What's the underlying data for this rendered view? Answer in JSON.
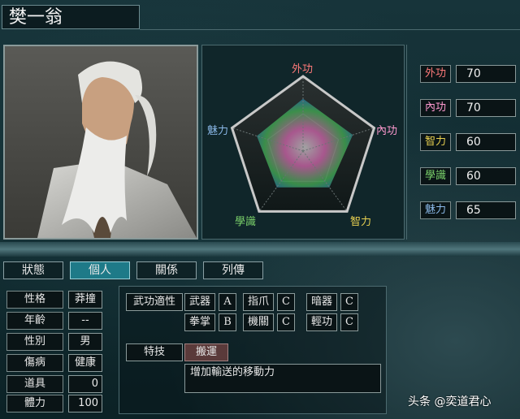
{
  "character": {
    "name": "樊一翁"
  },
  "radar": {
    "labels": {
      "outer": "外功",
      "inner": "內功",
      "wisdom": "智力",
      "knowledge": "學識",
      "charm": "魅力"
    },
    "label_colors": {
      "outer": "#ff7a7a",
      "inner": "#ff9ad0",
      "wisdom": "#e8d050",
      "knowledge": "#7ad06a",
      "charm": "#8ab8e8"
    }
  },
  "stats": [
    {
      "name": "外功",
      "value": "70",
      "color": "#ff7a7a"
    },
    {
      "name": "內功",
      "value": "70",
      "color": "#ff9ad0"
    },
    {
      "name": "智力",
      "value": "60",
      "color": "#e8d050"
    },
    {
      "name": "學識",
      "value": "60",
      "color": "#7ad06a"
    },
    {
      "name": "魅力",
      "value": "65",
      "color": "#8ab8e8"
    }
  ],
  "tabs": [
    {
      "label": "狀態",
      "active": false
    },
    {
      "label": "個人",
      "active": true
    },
    {
      "label": "關係",
      "active": false
    },
    {
      "label": "列傳",
      "active": false
    }
  ],
  "info": [
    {
      "name": "性格",
      "value": "莽撞"
    },
    {
      "name": "年齡",
      "value": "--"
    },
    {
      "name": "性別",
      "value": "男"
    },
    {
      "name": "傷病",
      "value": "健康"
    },
    {
      "name": "道具",
      "value": "0"
    },
    {
      "name": "體力",
      "value": "100"
    }
  ],
  "martial": {
    "header": "武功適性",
    "skills": [
      {
        "name": "武器",
        "grade": "A"
      },
      {
        "name": "指爪",
        "grade": "C"
      },
      {
        "name": "暗器",
        "grade": "C"
      },
      {
        "name": "拳掌",
        "grade": "B"
      },
      {
        "name": "機關",
        "grade": "C"
      },
      {
        "name": "輕功",
        "grade": "C"
      }
    ]
  },
  "special": {
    "header": "特技",
    "skill": "搬運",
    "description": "增加輸送的移動力"
  },
  "watermark": "头条 @奕道君心"
}
